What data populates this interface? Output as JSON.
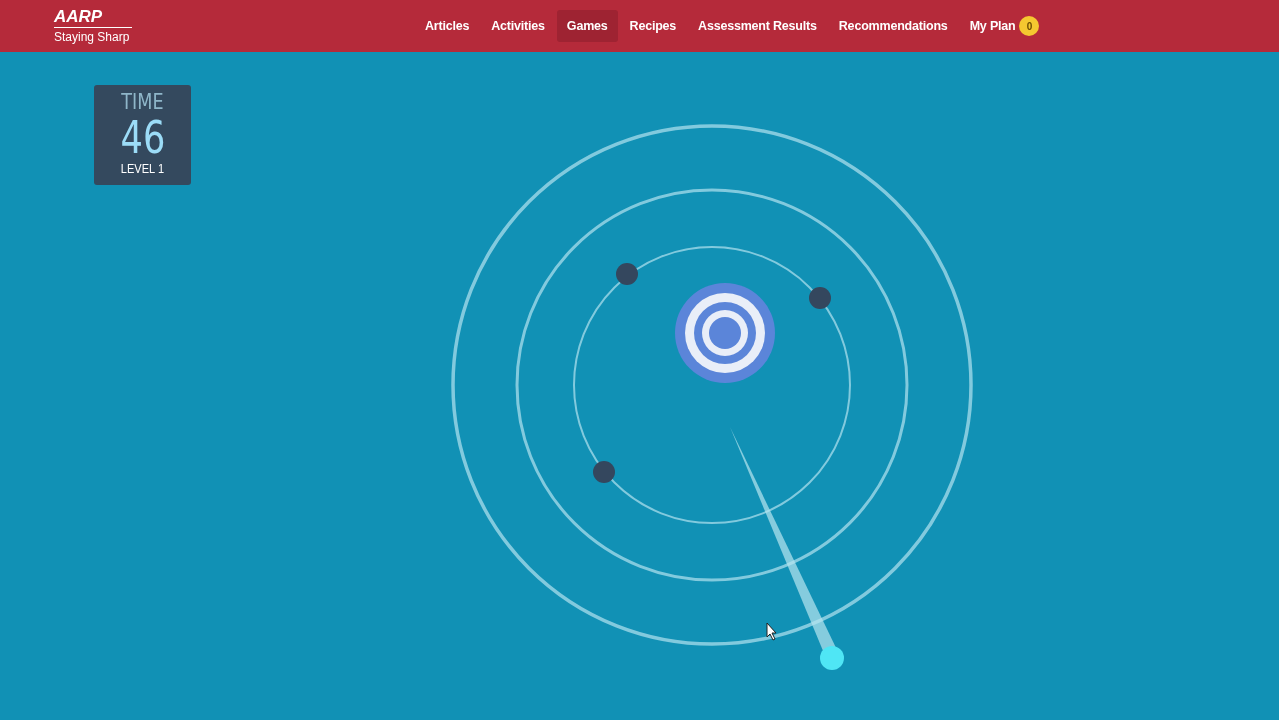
{
  "header": {
    "logo": "AARP",
    "tagline": "Staying Sharp"
  },
  "nav": [
    {
      "label": "Articles",
      "selected": false
    },
    {
      "label": "Activities",
      "selected": false
    },
    {
      "label": "Games",
      "selected": true
    },
    {
      "label": "Recipes",
      "selected": false
    },
    {
      "label": "Assessment Results",
      "selected": false
    },
    {
      "label": "Recommendations",
      "selected": false
    },
    {
      "label": "My Plan",
      "selected": false,
      "badge": "0"
    }
  ],
  "timer": {
    "label": "TIME",
    "value": "46",
    "level": "LEVEL 1"
  }
}
